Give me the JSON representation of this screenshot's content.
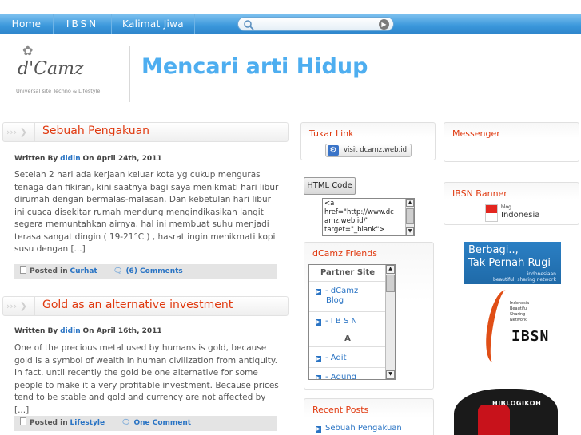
{
  "nav": {
    "items": [
      "Home",
      "IBSN",
      "Kalimat Jiwa"
    ]
  },
  "search": {
    "placeholder": ""
  },
  "header": {
    "logo_text": "d'Camz",
    "logo_tagline": "Universal site Techno & Lifestyle",
    "site_title": "Mencari arti Hidup"
  },
  "posts": [
    {
      "title": "Sebuah Pengakuan",
      "written_by_label": "Written By",
      "author": "didin",
      "date": "On April 24th, 2011",
      "body": "Setelah 2 hari ada kerjaan keluar kota yg cukup menguras tenaga dan fikiran, kini saatnya bagi saya menikmati hari libur dirumah dengan bermalas-malasan. Dan kebetulan hari libur ini cuaca disekitar rumah mendung mengindikasikan langit segera memuntahkan airnya, hal ini membuat suhu menjadi terasa sangat dingin ( 19-21°C ) , hasrat ingin menikmati kopi susu dengan [...]",
      "posted_in_label": "Posted in",
      "category": "Curhat",
      "comments": "(6) Comments"
    },
    {
      "title": "Gold as an alternative investment",
      "written_by_label": "Written By",
      "author": "didin",
      "date": "On April 16th, 2011",
      "body": "One of the precious metal used by humans is gold, because gold is a symbol of wealth in human civilization from antiquity. In fact, until recently the gold be one alternative for some people to make it a very profitable investment. Because prices tend to be stable and gold and currency are not affected by [...]",
      "posted_in_label": "Posted in",
      "category": "Lifestyle",
      "comments": "One Comment"
    }
  ],
  "sidebar": {
    "tukar_link": {
      "title": "Tukar Link",
      "visit_label": "visit dcamz.web.id"
    },
    "html_code": {
      "button_label": "HTML Code",
      "code": "<a\nhref=\"http://www.dc\namz.web.id/\"\ntarget=\"_blank\">"
    },
    "friends": {
      "title": "dCamz Friends",
      "header": "Partner Site",
      "items": [
        "- dCamz",
        "Blog",
        "- I B S N",
        "A",
        "- Adit",
        "- Agung"
      ]
    },
    "recent_posts": {
      "title": "Recent Posts",
      "items": [
        "Sebuah Pengakuan"
      ]
    },
    "messenger": {
      "title": "Messenger"
    },
    "ibsn_banner": {
      "title": "IBSN Banner",
      "badge_small": "blog",
      "badge_big": "Indonesia"
    },
    "berbagi": {
      "line1": "Berbagi..,",
      "line2": "Tak Pernah Rugi",
      "line3": "indonesiaan",
      "line4": "beautiful, sharing network"
    },
    "ibsn_logo": {
      "small_lines": [
        "Indonesia",
        "Beautiful",
        "Sharing",
        "Network"
      ],
      "word": "IBSN"
    },
    "hiblogi": {
      "text": "HIBLOGIKOH"
    }
  },
  "colors": {
    "nav": "#3a97db",
    "title": "#4eaef0",
    "accent": "#e03a10",
    "link": "#2a74c4"
  }
}
